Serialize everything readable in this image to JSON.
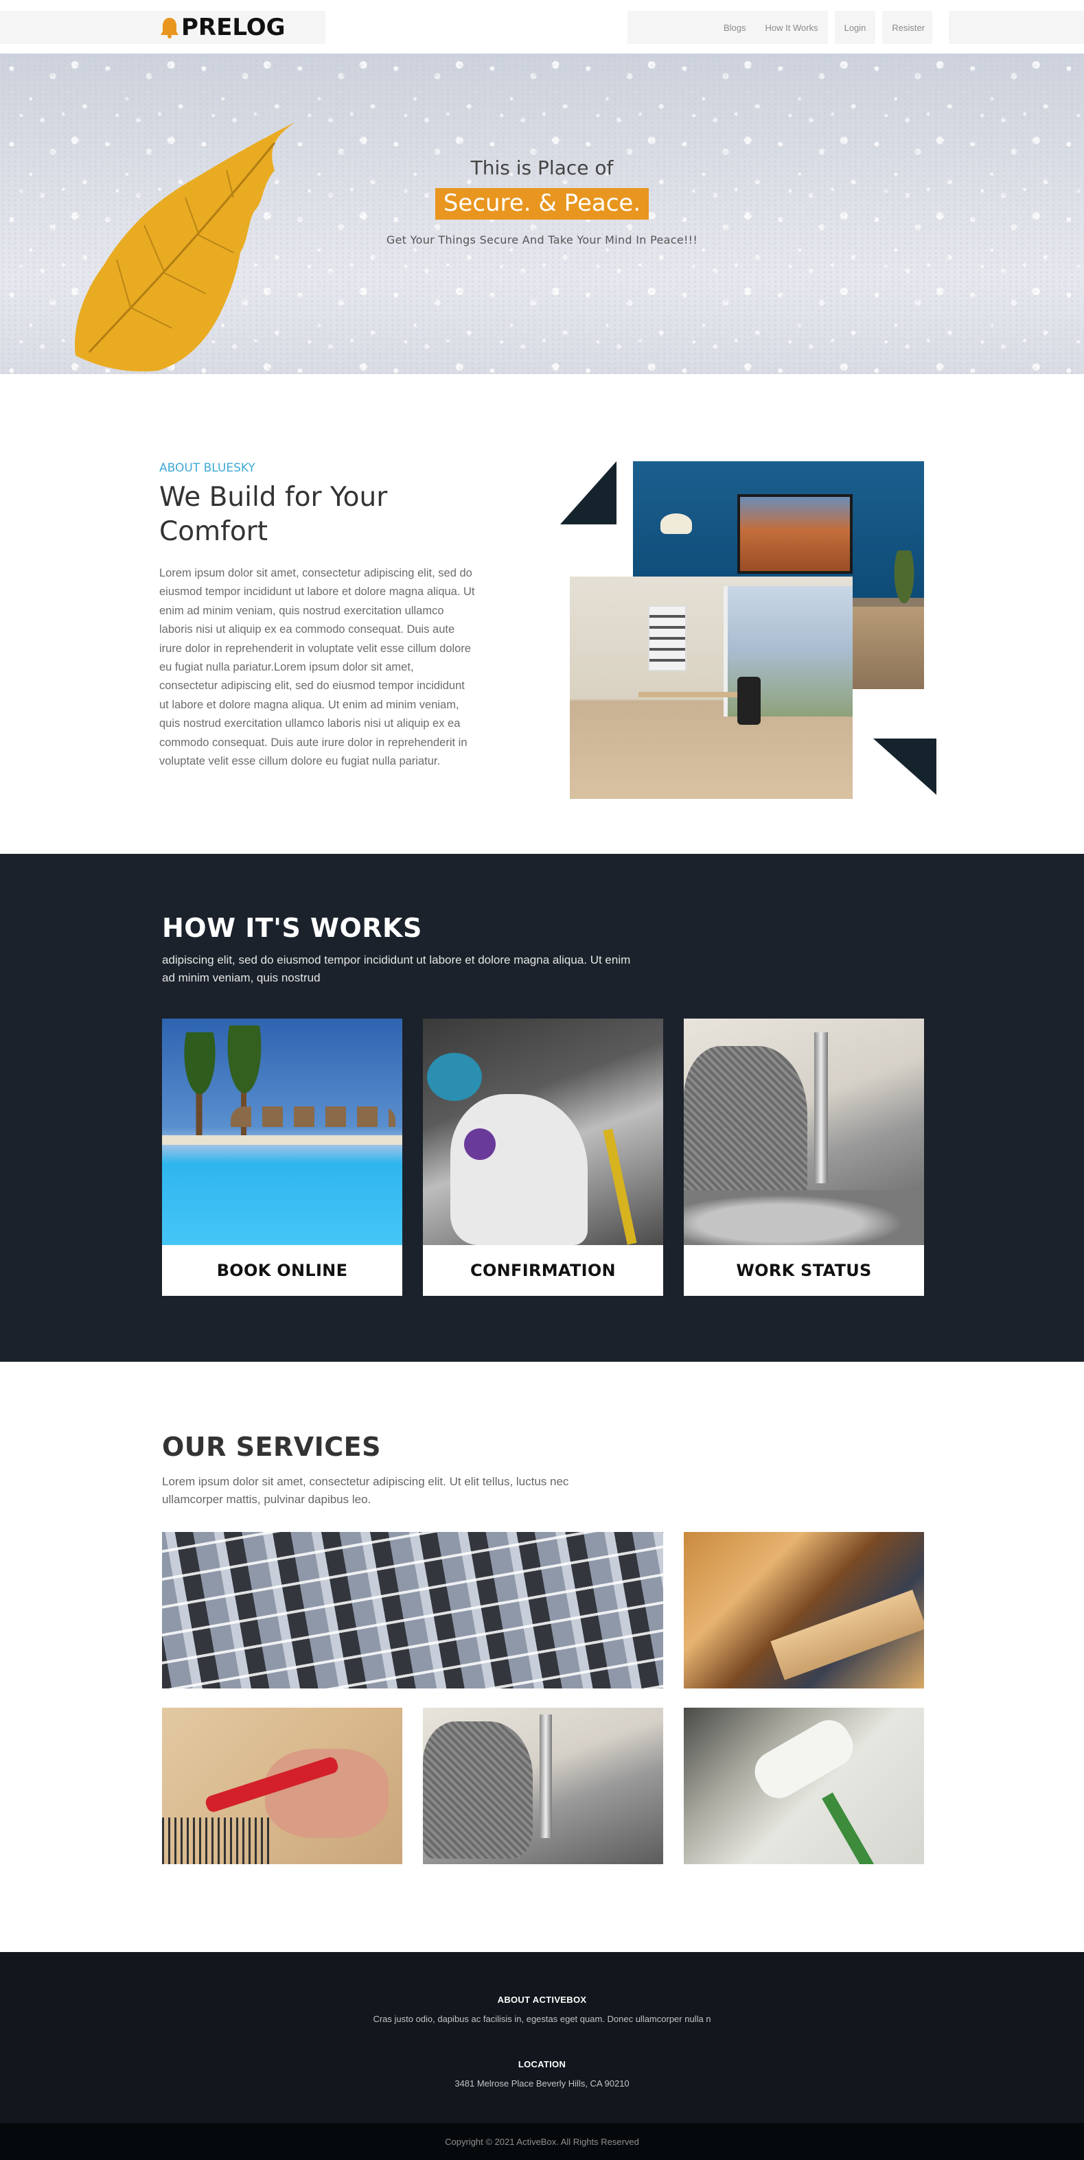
{
  "navbar": {
    "brand": "PRELOG",
    "brand_icon": "bell-icon",
    "items": [
      {
        "label": "Blogs"
      },
      {
        "label": "How It Works"
      },
      {
        "label": "Login"
      },
      {
        "label": "Resister"
      }
    ]
  },
  "hero": {
    "line1": "This is Place of",
    "highlight": "Secure. & Peace.",
    "subtitle": "Get Your Things Secure And Take Your Mind In Peace!!!",
    "highlight_color": "#e8961f"
  },
  "about": {
    "eyebrow": "ABOUT BLUESKY",
    "title": "We Build for Your Comfort",
    "body": "Lorem ipsum dolor sit amet, consectetur adipiscing elit, sed do eiusmod tempor incididunt ut labore et dolore magna aliqua. Ut enim ad minim veniam, quis nostrud exercitation ullamco laboris nisi ut aliquip ex ea commodo consequat. Duis aute irure dolor in reprehenderit in voluptate velit esse cillum dolore eu fugiat nulla pariatur.Lorem ipsum dolor sit amet, consectetur adipiscing elit, sed do eiusmod tempor incididunt ut labore et dolore magna aliqua. Ut enim ad minim veniam, quis nostrud exercitation ullamco laboris nisi ut aliquip ex ea commodo consequat. Duis aute irure dolor in reprehenderit in voluptate velit esse cillum dolore eu fugiat nulla pariatur.",
    "eyebrow_color": "#3fa9d6"
  },
  "how_it_works": {
    "title": "HOW IT'S WORKS",
    "subtitle": "adipiscing elit, sed do eiusmod tempor incididunt ut labore et dolore magna aliqua. Ut enim ad minim veniam, quis nostrud",
    "cards": [
      {
        "label": "BOOK ONLINE"
      },
      {
        "label": "CONFIRMATION"
      },
      {
        "label": "WORK STATUS"
      }
    ],
    "background": "#1b222b"
  },
  "services": {
    "title": "OUR SERVICES",
    "subtitle": "Lorem ipsum dolor sit amet, consectetur adipiscing elit. Ut elit tellus, luctus nec ullamcorper mattis, pulvinar dapibus leo."
  },
  "footer": {
    "about_heading": "ABOUT ACTIVEBOX",
    "about_text": "Cras justo odio, dapibus ac facilisis in,  egestas eget quam. Donec  ullamcorper nulla n",
    "location_heading": "LOCATION",
    "location_text": "3481 Melrose Place Beverly Hills, CA 90210",
    "copyright": "Copyright © 2021 ActiveBox. All Rights Reserved"
  }
}
